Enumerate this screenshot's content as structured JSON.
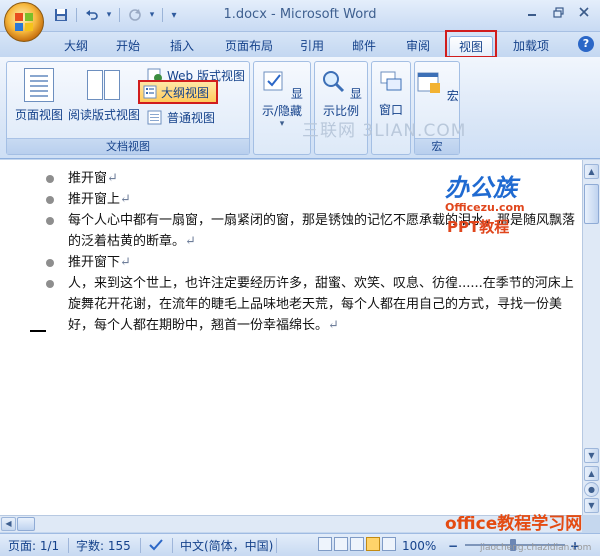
{
  "window": {
    "title": "1.docx - Microsoft Word"
  },
  "qat": {
    "save": "save-icon",
    "undo": "undo-icon",
    "redo": "redo-icon",
    "customize": "▾"
  },
  "tabs": [
    "大纲",
    "开始",
    "插入",
    "页面布局",
    "引用",
    "邮件",
    "审阅",
    "视图",
    "加载项"
  ],
  "active_tab": "视图",
  "ribbon": {
    "doc_views": {
      "label": "文档视图",
      "page_view": "页面视图",
      "reading_view": "阅读版式视图",
      "web_view": "Web 版式视图",
      "outline_view": "大纲视图",
      "draft_view": "普通视图"
    },
    "show_hide": "显示/隐藏",
    "zoom": "显示比例",
    "window": "窗口",
    "macro": "宏",
    "macro_group": "宏"
  },
  "watermarks": {
    "site": "三联网 3LIAN.COM",
    "brand_cn": "办公族",
    "brand_url": "Officezu.com",
    "brand_sub": "PPT教程",
    "footer": "office教程学习网",
    "footer_url": "jiaocheng.chazidian.com"
  },
  "document": {
    "items": [
      {
        "text": "推开窗",
        "mark": "↵"
      },
      {
        "text": "推开窗上",
        "mark": "↵"
      },
      {
        "text": "每个人心中都有一扇窗，一扇紧闭的窗，那是锈蚀的记忆不愿承载的泪水，那是随风飘落的泛着枯黄的断章。",
        "mark": "↵"
      },
      {
        "text": "推开窗下",
        "mark": "↵"
      },
      {
        "text": "人，来到这个世上，也许注定要经历许多，甜蜜、欢笑、叹息、彷徨......在季节的河床上旋舞花开花谢，在流年的睫毛上品味地老天荒，每个人都在用自己的方式，寻找一份美好，每个人都在期盼中，翘首一份幸福绵长。",
        "mark": "↵"
      }
    ]
  },
  "status": {
    "page": "页面: 1/1",
    "words": "字数: 155",
    "language": "中文(简体，中国)",
    "zoom": "100%"
  },
  "colors": {
    "accent": "#d11d1d",
    "ribbon_text": "#15428b",
    "brand": "#1f6ad1",
    "brand_alt": "#e0461c"
  }
}
